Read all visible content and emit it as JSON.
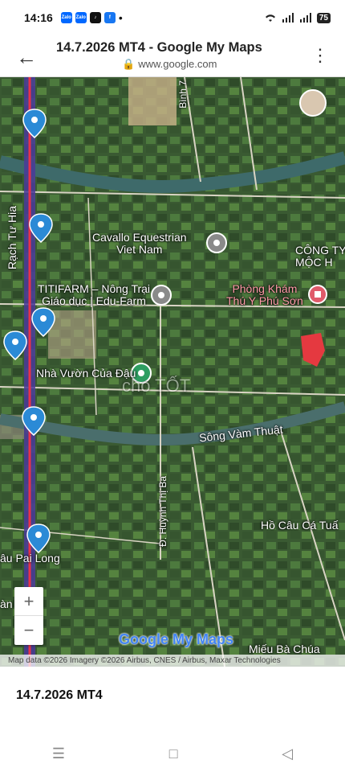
{
  "status": {
    "time": "14:16",
    "battery": "75",
    "app_icons": [
      {
        "name": "zalo-icon",
        "label": "Zalo",
        "color": "#0068ff"
      },
      {
        "name": "zalo-icon-2",
        "label": "Zalo",
        "color": "#0068ff"
      },
      {
        "name": "tiktok-icon",
        "label": "♪",
        "color": "#111111"
      },
      {
        "name": "facebook-icon",
        "label": "f",
        "color": "#1877f2"
      }
    ]
  },
  "browser": {
    "title": "14.7.2026 MT4 - Google My Maps",
    "url": "www.google.com",
    "back_icon": "arrow-left-icon",
    "menu_icon": "more-vert-icon"
  },
  "map": {
    "labels": {
      "rach_tu_hia": "Rạch Tư Hia",
      "binh7": "Bình 7",
      "cavallo": "Cavallo Equestrian\nViet Nam",
      "cong_ty": "CÔNG TY\nMỘC H",
      "titifarm": "TITIFARM – Nông Trại\nGiáo dục | Edu-Farm",
      "phong_kham": "Phòng Khám\nThú Y Phú Sơn",
      "nha_vuon": "Nhà Vườn Của Đậu",
      "song_vam_thuat": "Sông Vàm Thuật",
      "huynh_thi_ba": "Đ. Huỳnh Thị Ba",
      "ho_cau": "Hồ Câu Cá Tuấ",
      "cau_pai_long": "âu Pai Long",
      "an": "àn",
      "mieu": "Miếu Bà Chúa",
      "watermark": "cho TỐT"
    },
    "zoom_in": "+",
    "zoom_out": "−",
    "logo": "Google My Maps",
    "attribution": "Map data ©2026 Imagery ©2026 Airbus, CNES / Airbus, Maxar Technologies"
  },
  "caption": "14.7.2026 MT4",
  "navbar": {
    "recents": "☰",
    "home": "□",
    "back": "◁"
  }
}
